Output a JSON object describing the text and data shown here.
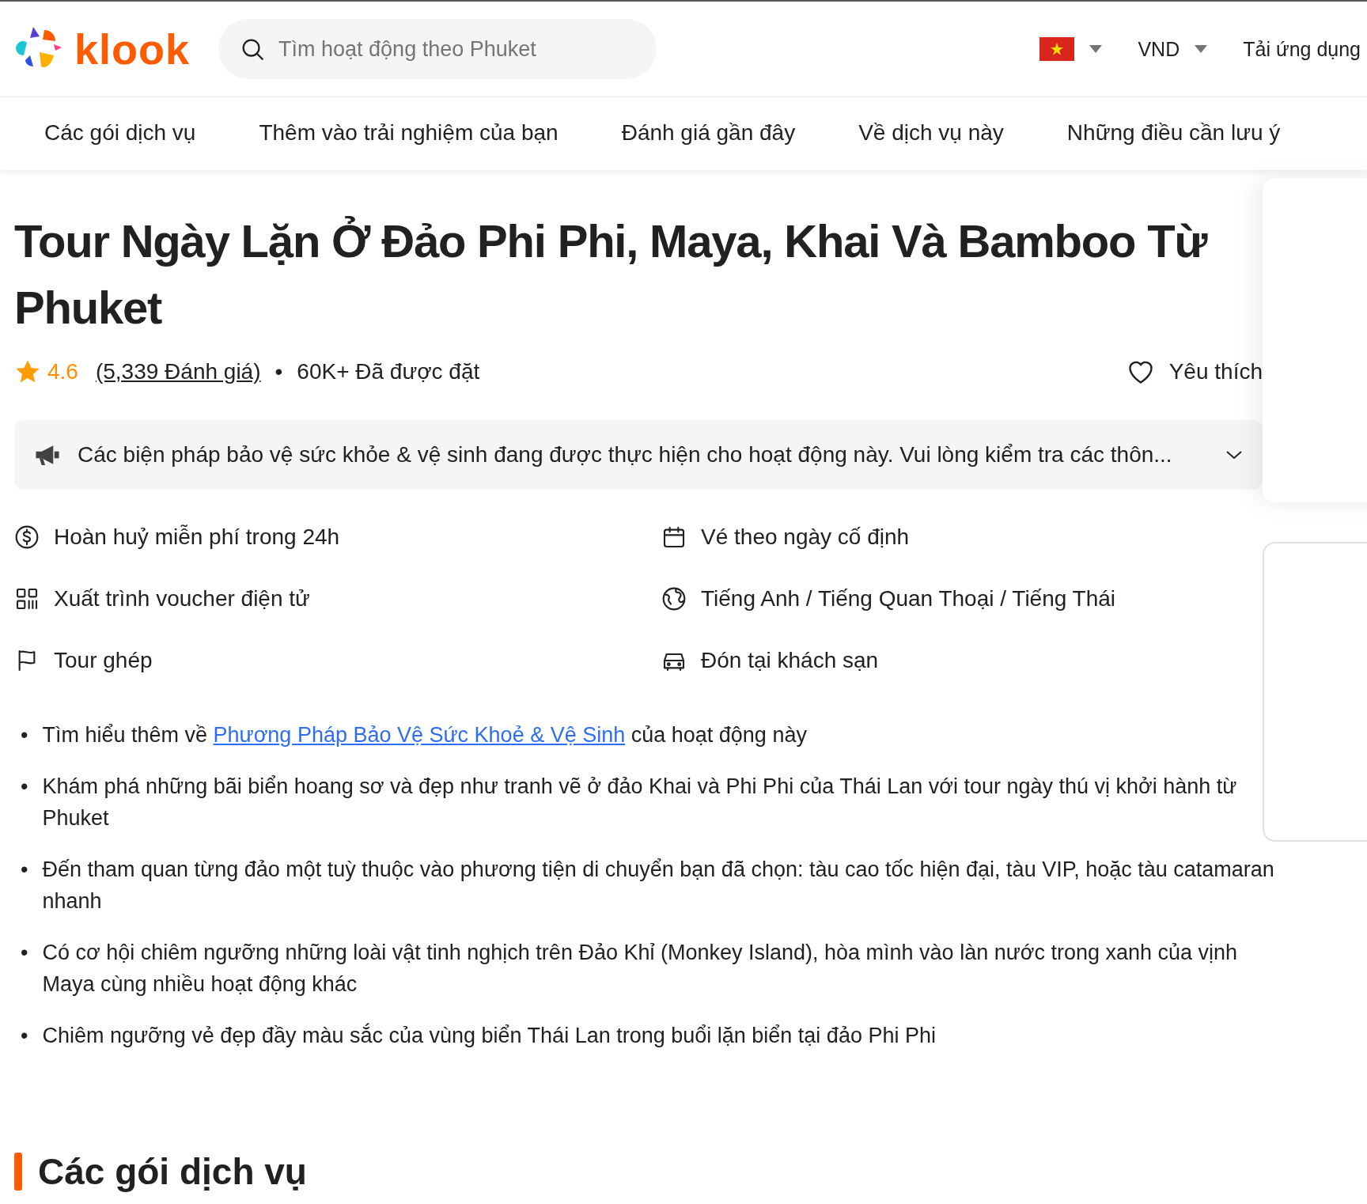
{
  "header": {
    "logo": "klook",
    "search": {
      "placeholder": "Tìm hoạt động theo Phuket"
    },
    "currency": "VND",
    "app_link": "Tải ứng dụng"
  },
  "nav": [
    {
      "label": "Các gói dịch vụ",
      "selected": false
    },
    {
      "label": "Thêm vào trải nghiệm của bạn",
      "selected": false
    },
    {
      "label": "Đánh giá gần đây",
      "selected": false
    },
    {
      "label": "Về dịch vụ này",
      "selected": false
    },
    {
      "label": "Những điều cần lưu ý",
      "selected": false
    }
  ],
  "title": "Tour Ngày Lặn Ở Đảo Phi Phi, Maya, Khai Và Bamboo Từ Phuket",
  "rating": {
    "score": "4.6",
    "reviews": "(5,339 Đánh giá)",
    "separator": "•",
    "booked": "60K+ Đã được đặt"
  },
  "wishlist": {
    "label": "Yêu thích",
    "saved": false
  },
  "notice": {
    "text": "Các biện pháp bảo vệ sức khỏe & vệ sinh đang được thực hiện cho hoạt động này. Vui lòng kiểm tra các thôn...",
    "expanded": false
  },
  "features": [
    {
      "kind": "refund",
      "text": "Hoàn huỷ miễn phí trong 24h"
    },
    {
      "kind": "calendar",
      "text": "Vé theo ngày cố định"
    },
    {
      "kind": "voucher",
      "text": "Xuất trình voucher điện tử"
    },
    {
      "kind": "language",
      "text": "Tiếng Anh / Tiếng Quan Thoại / Tiếng Thái"
    },
    {
      "kind": "tour",
      "text": "Tour ghép"
    },
    {
      "kind": "pickup",
      "text": "Đón tại khách sạn"
    }
  ],
  "bullet": "•",
  "highlights": [
    {
      "before": "Tìm hiểu thêm về ",
      "link": "Phương Pháp Bảo Vệ Sức Khoẻ & Vệ Sinh",
      "after": " của hoạt động này"
    },
    {
      "before": "Khám phá những bãi biển hoang sơ và đẹp như tranh vẽ ở đảo Khai và Phi Phi của Thái Lan với tour ngày thú vị khởi hành từ Phuket"
    },
    {
      "before": "Đến tham quan từng đảo một tuỳ thuộc vào phương tiện di chuyển bạn đã chọn: tàu cao tốc hiện đại, tàu VIP, hoặc tàu catamaran nhanh"
    },
    {
      "before": "Có cơ hội chiêm ngưỡng những loài vật tinh nghịch trên Đảo Khỉ (Monkey Island), hòa mình vào làn nước trong xanh của vịnh Maya cùng nhiều hoạt động khác"
    },
    {
      "before": "Chiêm ngưỡng vẻ đẹp đầy màu sắc của vùng biển Thái Lan trong buổi lặn biển tại đảo Phi Phi"
    }
  ],
  "section_heading": "Các gói dịch vụ"
}
